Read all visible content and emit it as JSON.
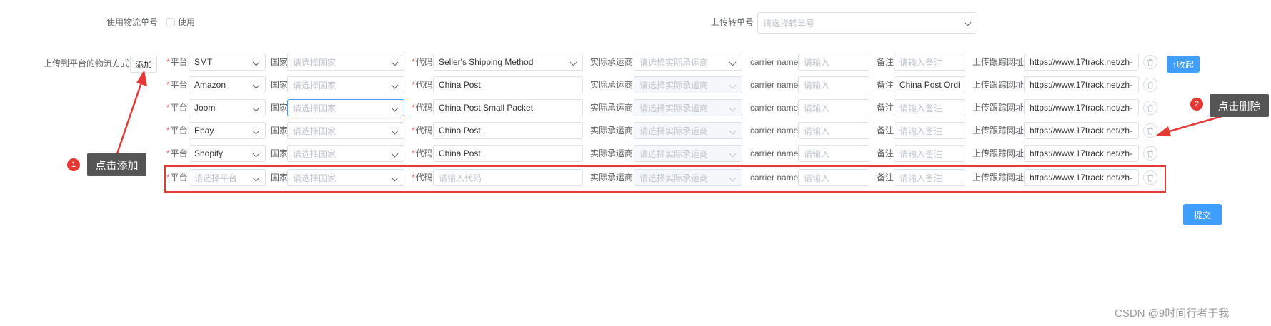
{
  "form": {
    "use_tracking_label": "使用物流单号",
    "use_checkbox_label": "使用",
    "upload_transfer_label": "上传转单号",
    "upload_transfer_placeholder": "请选择转单号",
    "method_label": "上传到平台的物流方式",
    "add_button": "添加",
    "collapse_button": "↑收起",
    "submit_button": "提交"
  },
  "labels": {
    "platform": "平台",
    "country": "国家",
    "code": "代码",
    "carrier": "实际承运商",
    "carrier_name": "carrier name",
    "remark": "备注",
    "tracking_url": "上传跟踪网址"
  },
  "rows": [
    {
      "platform": "SMT",
      "country": "请选择国家",
      "code": "Seller's Shipping Method",
      "carrier": "请选择实际承运商",
      "carrier_name": "请输入",
      "remark": "请输入备注",
      "url": "https://www.17track.net/zh-"
    },
    {
      "platform": "Amazon",
      "country": "请选择国家",
      "code": "China Post",
      "carrier": "请选择实际承运商",
      "carrier_name": "请输入",
      "remark": "China Post Ordi",
      "url": "https://www.17track.net/zh-"
    },
    {
      "platform": "Joom",
      "country": "请选择国家",
      "code": "China Post Small Packet",
      "carrier": "请选择实际承运商",
      "carrier_name": "请输入",
      "remark": "请输入备注",
      "url": "https://www.17track.net/zh-"
    },
    {
      "platform": "Ebay",
      "country": "请选择国家",
      "code": "China Post",
      "carrier": "请选择实际承运商",
      "carrier_name": "请输入",
      "remark": "请输入备注",
      "url": "https://www.17track.net/zh-"
    },
    {
      "platform": "Shopify",
      "country": "请选择国家",
      "code": "China Post",
      "carrier": "请选择实际承运商",
      "carrier_name": "请输入",
      "remark": "请输入备注",
      "url": "https://www.17track.net/zh-"
    },
    {
      "platform": "请选择平台",
      "country": "请选择国家",
      "code": "请输入代码",
      "carrier": "请选择实际承运商",
      "carrier_name": "请输入",
      "remark": "请输入备注",
      "url": "https://www.17track.net/zh-"
    }
  ],
  "annotations": {
    "add_badge": "1",
    "add_tip": "点击添加",
    "delete_badge": "2",
    "delete_tip": "点击删除",
    "highlight_color": "#e53935"
  },
  "watermark": "CSDN @9时间行者于我"
}
